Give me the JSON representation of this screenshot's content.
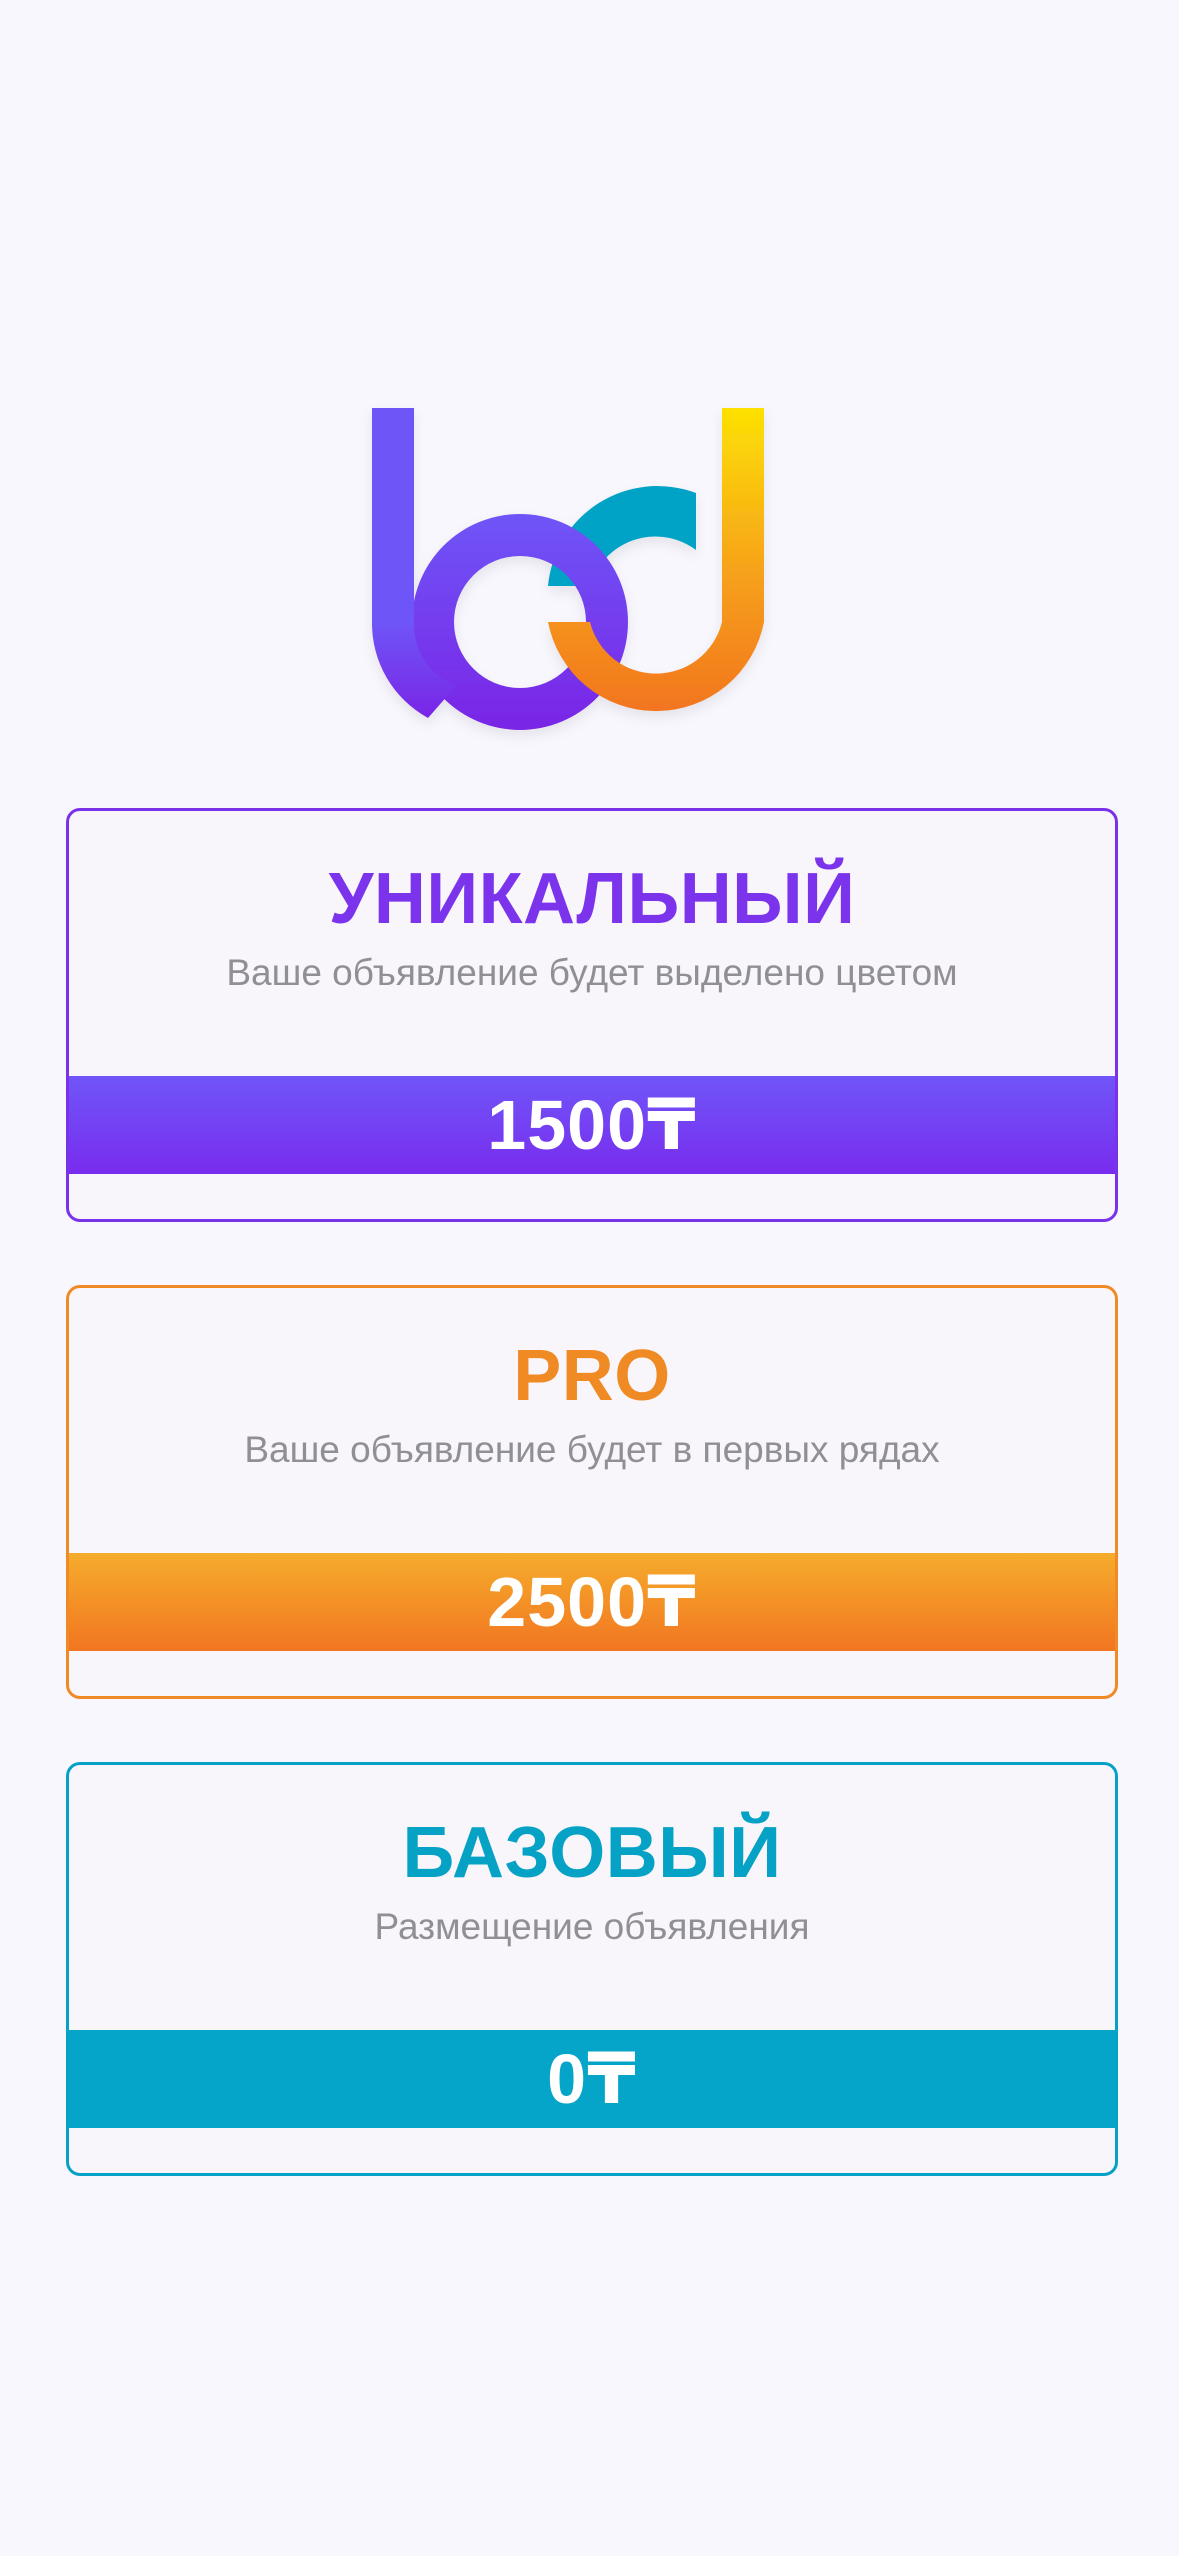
{
  "logo": {
    "icon": "bd-logo",
    "colors": {
      "purple_top": "#6e55f7",
      "purple_bottom": "#7a25e6",
      "teal": "#06a3c6",
      "yellow": "#fde103",
      "orange": "#f27520"
    }
  },
  "plans": [
    {
      "title": "УНИКАЛЬНЫЙ",
      "description": "Ваше объявление будет выделено цветом",
      "price": "1500₸",
      "color": "#7b34ec"
    },
    {
      "title": "PRO",
      "description": "Ваше объявление будет в первых рядах",
      "price": "2500₸",
      "color": "#f08a24"
    },
    {
      "title": "БАЗОВЫЙ",
      "description": "Размещение объявления",
      "price": "0₸",
      "color": "#05a2c5"
    }
  ]
}
